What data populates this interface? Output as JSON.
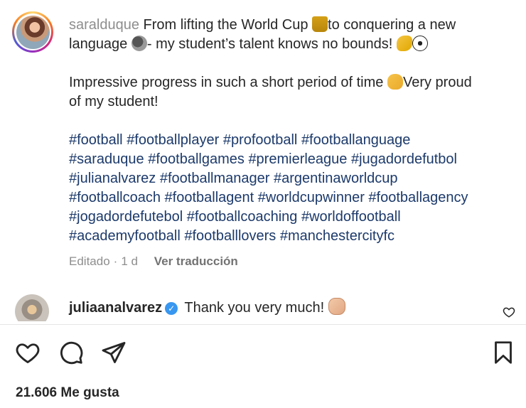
{
  "post": {
    "author": "saralduque",
    "caption_line1_a": "From lifting the World Cup ",
    "caption_line1_b": "to conquering a new",
    "caption_line2_a": "language ",
    "caption_line2_b": "- my student’s talent knows no bounds! ",
    "caption_para2_a": "Impressive progress in such a short period of time ",
    "caption_para2_b": "Very proud",
    "caption_para2_c": "of my student!",
    "hashtags": [
      [
        "#football",
        "#footballplayer",
        "#profootball",
        "#footballanguage"
      ],
      [
        "#saraduque",
        "#footballgames",
        "#premierleague",
        "#jugadordefutbol"
      ],
      [
        "#julianalvarez",
        "#footballmanager",
        "#argentinaworldcup"
      ],
      [
        "#footballcoach",
        "#footballagent",
        "#worldcupwinner",
        "#footballagency"
      ],
      [
        "#jogadordefutebol",
        "#footballcoaching",
        "#worldoffootball"
      ],
      [
        "#academyfootball",
        "#footballlovers",
        "#manchestercityfc"
      ]
    ],
    "meta": {
      "edited": "Editado",
      "separator": "·",
      "age": "1 d",
      "translate": "Ver traducción"
    }
  },
  "comment": {
    "user": "juliaanalvarez",
    "verified_mark": "✓",
    "text": "Thank you very much! "
  },
  "actions": {
    "icons": [
      "heart-icon",
      "comment-icon",
      "share-icon",
      "bookmark-icon"
    ]
  },
  "likes": "21.606 Me gusta",
  "colors": {
    "text": "#262626",
    "muted": "#8e8e8e",
    "hashtag": "#1c3a6b",
    "verified": "#3897f0"
  }
}
